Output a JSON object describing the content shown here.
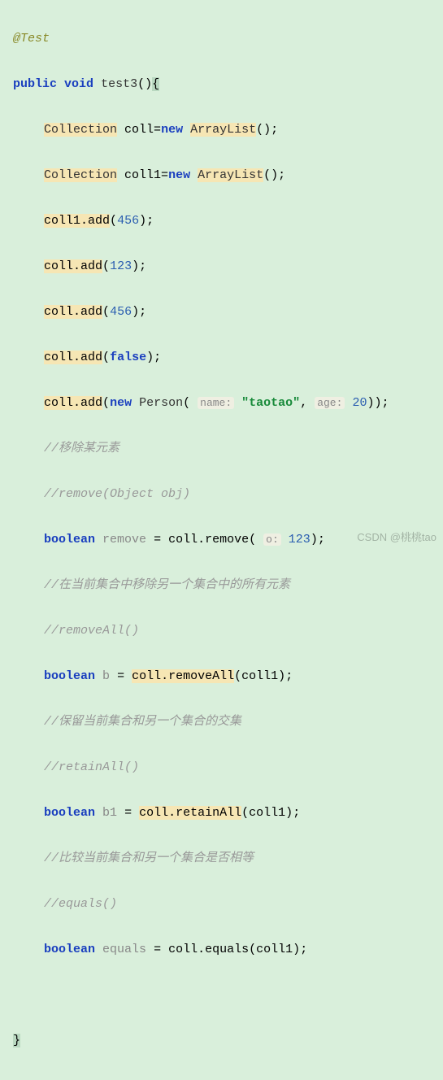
{
  "watermark": "CSDN @桃桃tao",
  "code": {
    "annotation": "@Test",
    "kw_public": "public",
    "kw_void": "void",
    "method_name": "test3",
    "paren_open": "(",
    "paren_close": ")",
    "brace_open": "{",
    "brace_close": "}",
    "type_collection": "Collection",
    "var_coll": "coll",
    "var_coll1": "coll1",
    "op_eq": "=",
    "kw_new": "new",
    "type_arraylist": "ArrayList",
    "empty_args": "()",
    "semi": ";",
    "dot": ".",
    "m_add": "add",
    "n456": "456",
    "n123": "123",
    "kw_false": "false",
    "type_person": "Person",
    "hint_name": "name:",
    "str_taotao": "\"taotao\"",
    "comma_sp": ", ",
    "hint_age": "age:",
    "n20": "20",
    "sp": " ",
    "cmt_remove_elem": "//移除某元素",
    "cmt_remove_sig": "//remove(Object obj)",
    "kw_boolean": "boolean",
    "var_remove": "remove",
    "m_remove": "remove",
    "hint_o": "o:",
    "cmt_removeall_desc": "//在当前集合中移除另一个集合中的所有元素",
    "cmt_removeall_sig": "//removeAll()",
    "var_b": "b",
    "m_removeAll": "removeAll",
    "cmt_retain_desc": "//保留当前集合和另一个集合的交集",
    "cmt_retain_sig": "//retainAll()",
    "var_b1": "b1",
    "m_retainAll": "retainAll",
    "cmt_equals_desc": "//比较当前集合和另一个集合是否相等",
    "cmt_equals_sig": "//equals()",
    "var_equals": "equals",
    "m_equals": "equals"
  }
}
